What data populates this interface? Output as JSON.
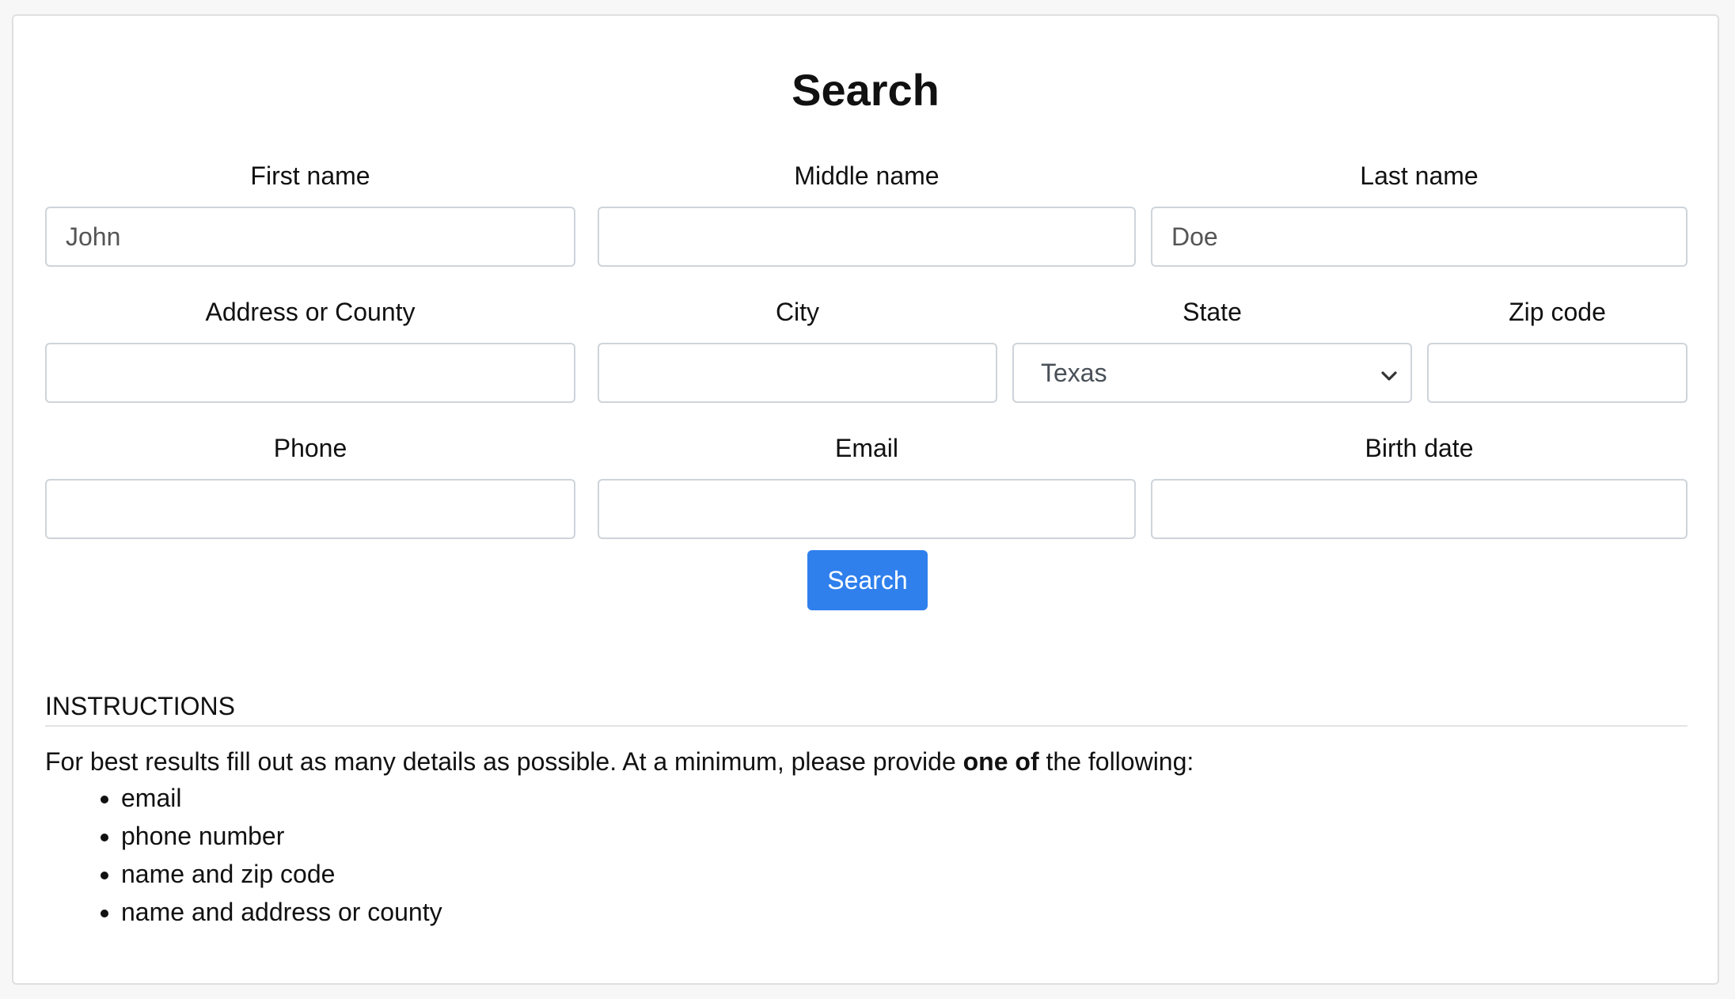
{
  "title": "Search",
  "fields": {
    "first_name": {
      "label": "First name",
      "placeholder": "John"
    },
    "middle_name": {
      "label": "Middle name",
      "placeholder": ""
    },
    "last_name": {
      "label": "Last name",
      "placeholder": "Doe"
    },
    "address": {
      "label": "Address or County",
      "placeholder": ""
    },
    "city": {
      "label": "City",
      "placeholder": ""
    },
    "state": {
      "label": "State",
      "value": "Texas"
    },
    "zip": {
      "label": "Zip code",
      "placeholder": ""
    },
    "phone": {
      "label": "Phone",
      "placeholder": ""
    },
    "email": {
      "label": "Email",
      "placeholder": ""
    },
    "birth_date": {
      "label": "Birth date",
      "placeholder": ""
    }
  },
  "search_button": "Search",
  "instructions": {
    "heading": "INSTRUCTIONS",
    "text_before": "For best results fill out as many details as possible. At a minimum, please provide ",
    "text_bold": "one of",
    "text_after": " the following:",
    "items": [
      "email",
      "phone number",
      "name and zip code",
      "name and address or county"
    ]
  },
  "colors": {
    "button": "#2f80ed",
    "background": "#f7f7f7",
    "border": "#ced4da"
  },
  "icons": {
    "state_select": "chevron-down-icon"
  }
}
